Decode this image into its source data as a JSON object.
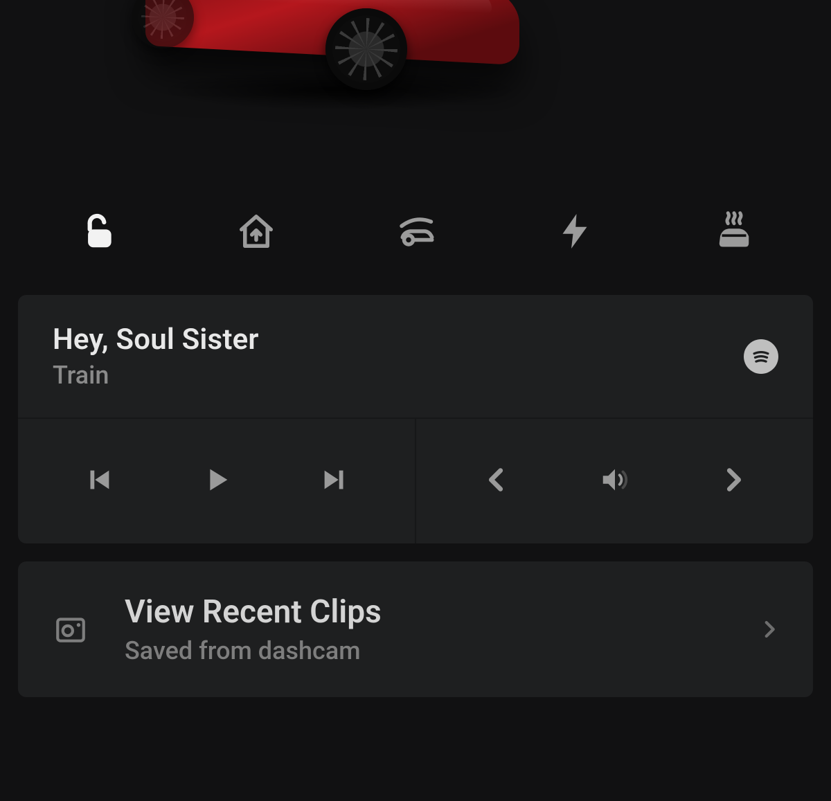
{
  "quick_actions": {
    "lock": {
      "name": "lock-toggle"
    },
    "home": {
      "name": "homelink"
    },
    "frunk": {
      "name": "open-frunk"
    },
    "charge": {
      "name": "charging"
    },
    "climate": {
      "name": "climate-defrost"
    }
  },
  "media": {
    "track_title": "Hey, Soul Sister",
    "track_artist": "Train",
    "source": "spotify"
  },
  "clips": {
    "title": "View Recent Clips",
    "subtitle": "Saved from dashcam"
  }
}
